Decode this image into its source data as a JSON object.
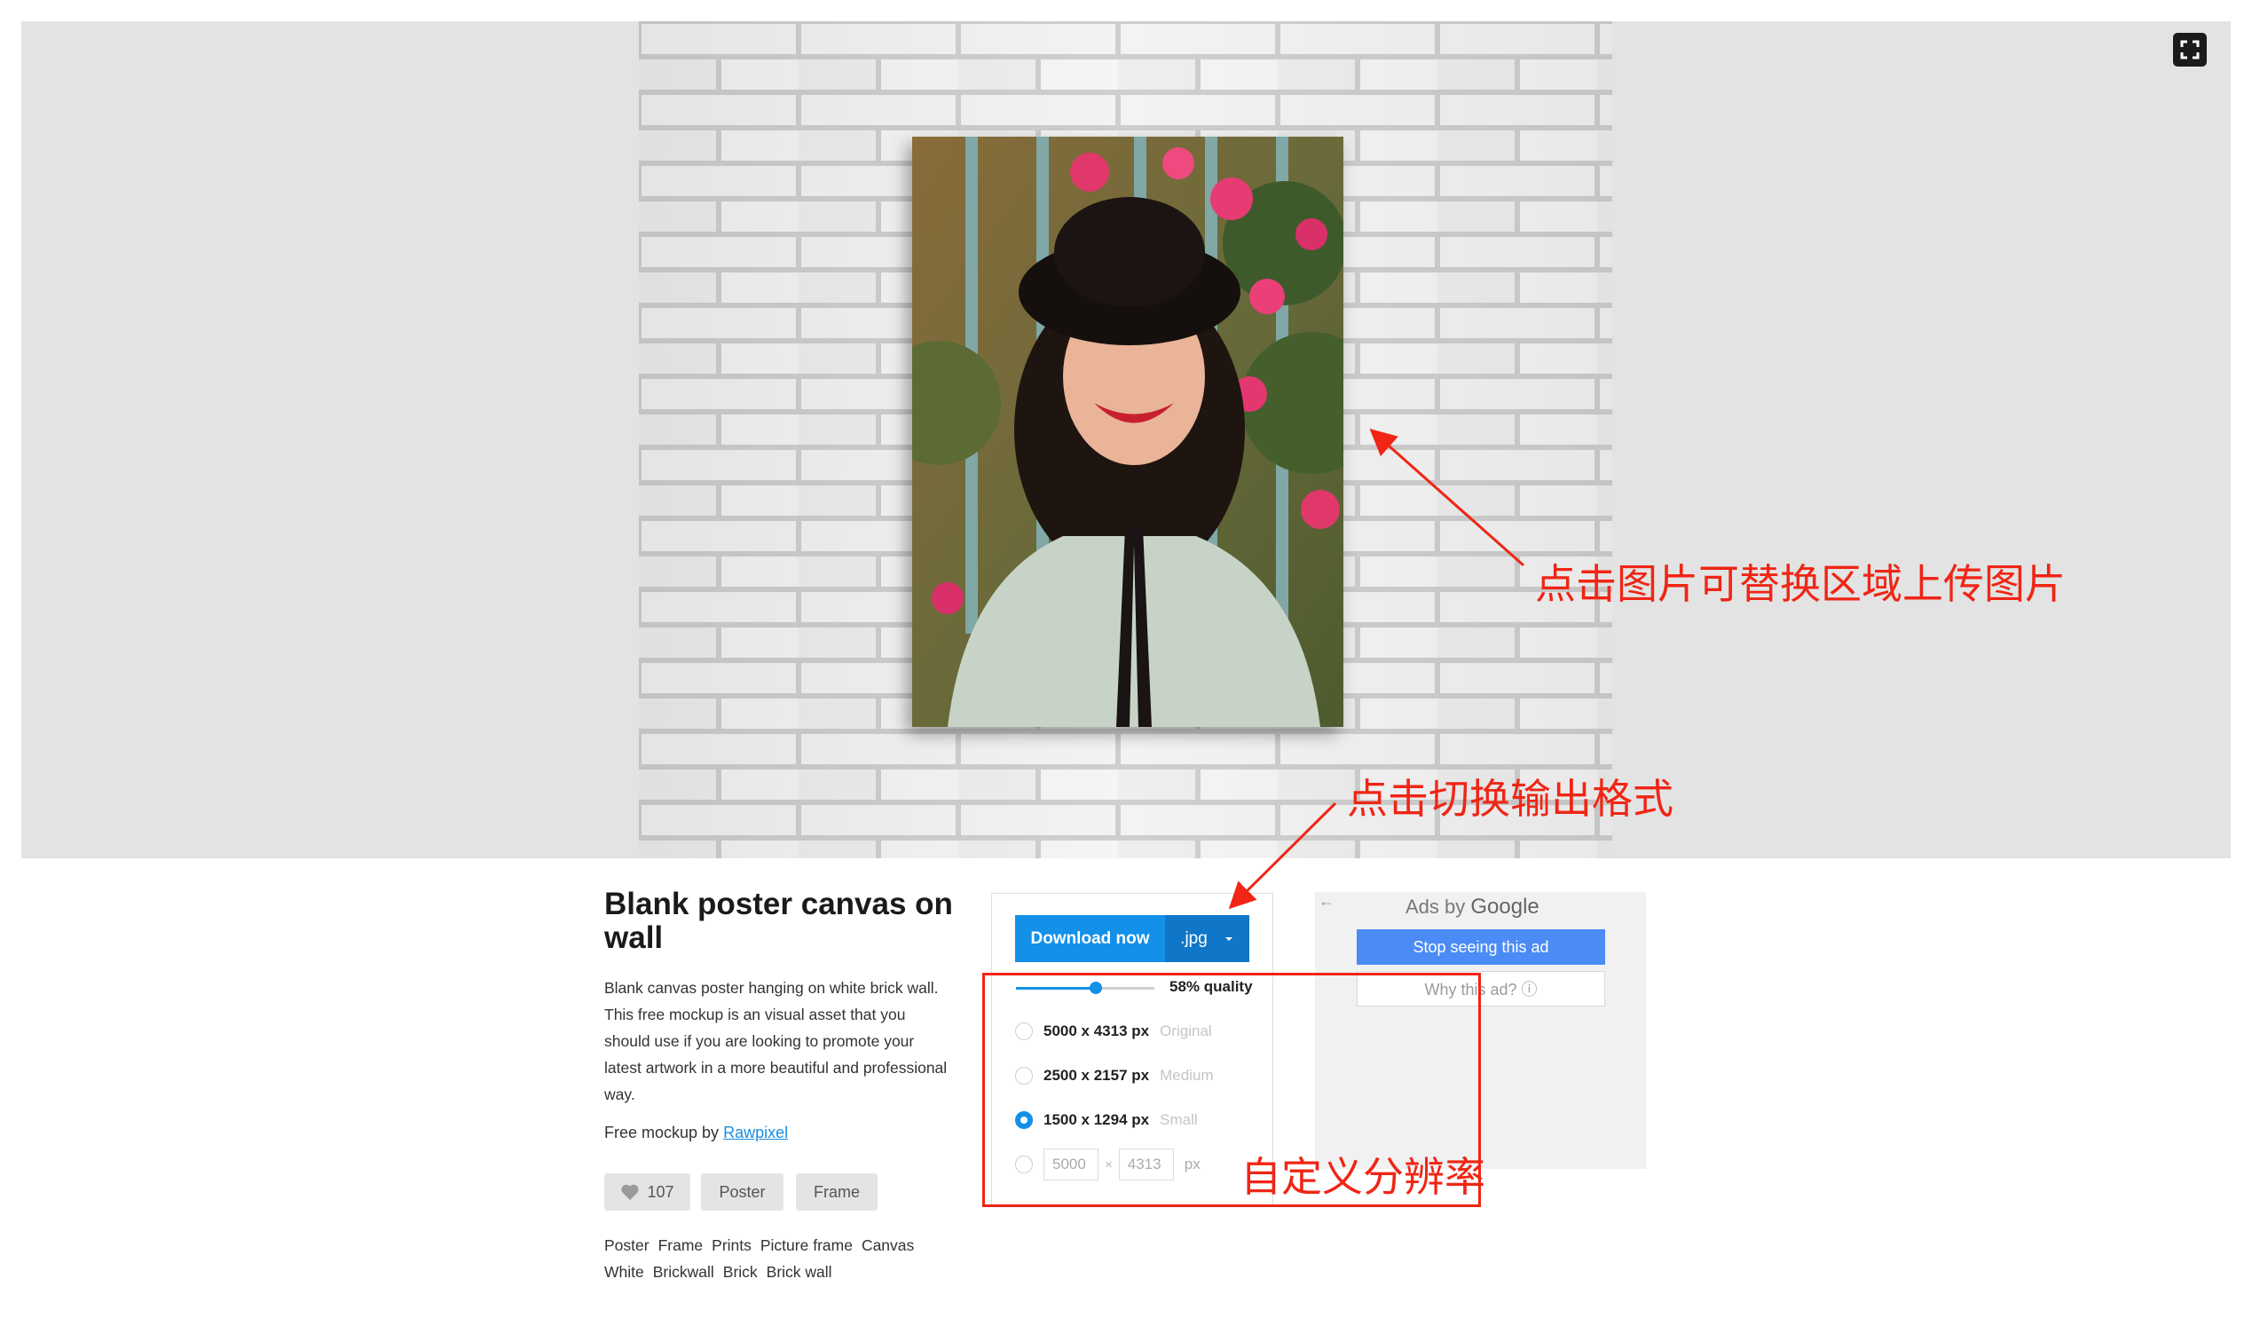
{
  "preview": {
    "fullscreen_icon": "fullscreen-icon"
  },
  "annotations": {
    "replace_image": "点击图片可替换区域上传图片",
    "switch_format": "点击切换输出格式",
    "custom_resolution": "自定义分辨率"
  },
  "info": {
    "title": "Blank poster canvas on wall",
    "description": "Blank canvas poster hanging on white brick wall. This free mockup is an visual asset that you should use if you are looking to promote your latest artwork in a more beautiful and professional way.",
    "credit_prefix": "Free mockup by",
    "credit_author": "Rawpixel",
    "likes": "107",
    "tag_buttons": [
      "Poster",
      "Frame"
    ],
    "tags": [
      "Poster",
      "Frame",
      "Prints",
      "Picture frame",
      "Canvas",
      "White",
      "Brickwall",
      "Brick",
      "Brick wall"
    ]
  },
  "download": {
    "button_label": "Download now",
    "format": ".jpg",
    "quality_value": 58,
    "quality_label": "58% quality",
    "sizes": [
      {
        "dims": "5000 x 4313 px",
        "label": "Original",
        "selected": false
      },
      {
        "dims": "2500 x 2157 px",
        "label": "Medium",
        "selected": false
      },
      {
        "dims": "1500 x 1294 px",
        "label": "Small",
        "selected": true
      }
    ],
    "custom": {
      "width": "5000",
      "height": "4313",
      "times": "×",
      "unit": "px"
    }
  },
  "ad": {
    "ads_by": "Ads by",
    "brand": "Google",
    "stop_label": "Stop seeing this ad",
    "why_label": "Why this ad? ⓘ"
  },
  "colors": {
    "accent": "#1390e8",
    "accent_dark": "#1077c8",
    "annotation": "#f02515",
    "ad_button": "#4b8bf5"
  }
}
